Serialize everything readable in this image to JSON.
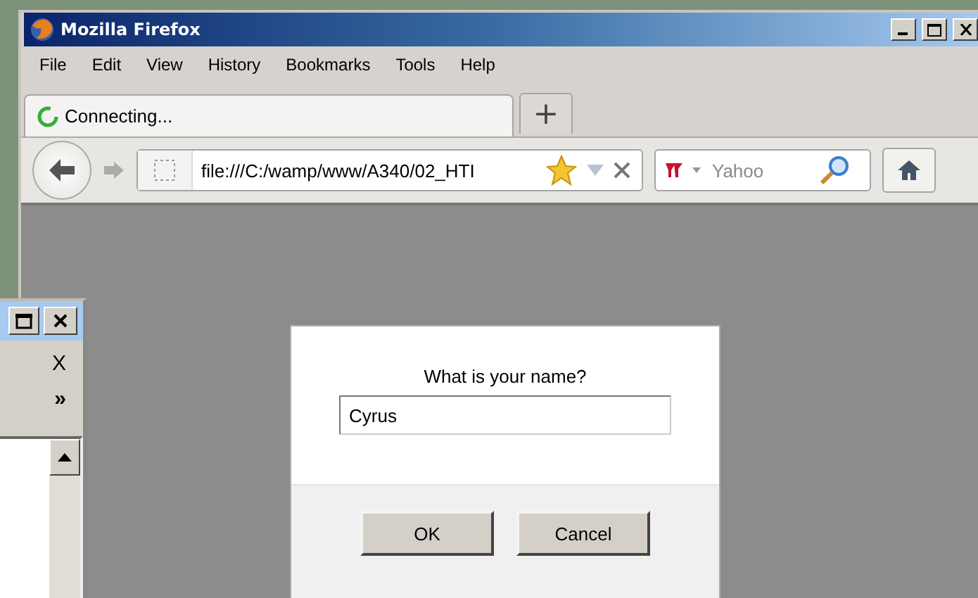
{
  "window": {
    "title": "Mozilla Firefox"
  },
  "menu": [
    {
      "label": "File"
    },
    {
      "label": "Edit"
    },
    {
      "label": "View"
    },
    {
      "label": "History"
    },
    {
      "label": "Bookmarks"
    },
    {
      "label": "Tools"
    },
    {
      "label": "Help"
    }
  ],
  "tabs": [
    {
      "label": "Connecting...",
      "selected": true
    }
  ],
  "new_tab": "+",
  "address": {
    "value": "file:///C:/wamp/www/A340/02_HTI"
  },
  "search": {
    "placeholder": "Yahoo"
  },
  "dialog": {
    "prompt": "What is your name?",
    "value": "Cyrus",
    "buttons": [
      "OK",
      "Cancel"
    ]
  },
  "side_window": {
    "close_glyph": "X",
    "overflow_glyph": "»"
  }
}
